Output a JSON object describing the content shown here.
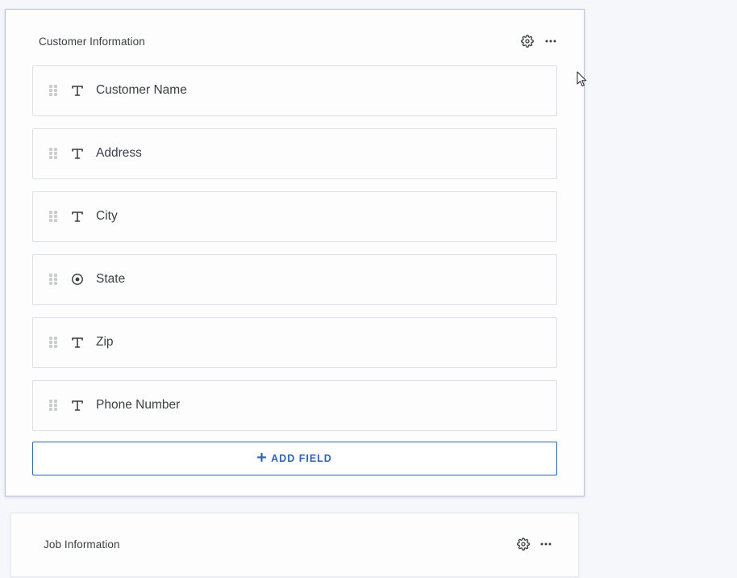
{
  "sections": [
    {
      "title": "Customer Information",
      "fields": [
        {
          "label": "Customer Name",
          "type_icon": "text-type-icon"
        },
        {
          "label": "Address",
          "type_icon": "text-type-icon"
        },
        {
          "label": "City",
          "type_icon": "text-type-icon"
        },
        {
          "label": "State",
          "type_icon": "radio-type-icon"
        },
        {
          "label": "Zip",
          "type_icon": "text-type-icon"
        },
        {
          "label": "Phone Number",
          "type_icon": "text-type-icon"
        }
      ],
      "add_field_label": "ADD FIELD",
      "add_field_icon": "plus-icon",
      "settings_icon": "gear-icon",
      "menu_icon": "more-horizontal-icon"
    },
    {
      "title": "Job Information",
      "settings_icon": "gear-icon",
      "menu_icon": "more-horizontal-icon"
    }
  ],
  "colors": {
    "accent": "#2f64b4",
    "page_background": "#f6f7fb",
    "card_border_active": "#b9c6dc",
    "field_border": "#dcdfe4",
    "text": "#3b3e43",
    "handle": "#c9ccd1"
  }
}
